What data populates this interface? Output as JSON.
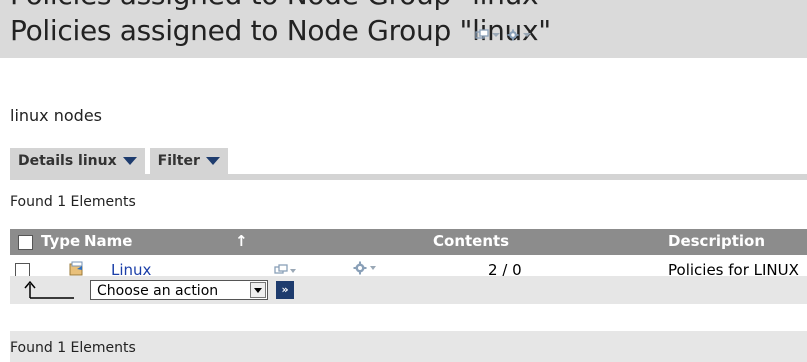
{
  "header": {
    "title_cut": "Policies assigned to Node Group \"linux\"",
    "title": "Policies assigned to Node Group \"linux\"",
    "title_tool_icons": [
      "window-icon",
      "gear-icon"
    ]
  },
  "subtitle": "linux nodes",
  "tabs": [
    {
      "label": "Details linux"
    },
    {
      "label": "Filter"
    }
  ],
  "found_top": "Found 1 Elements",
  "found_bottom": "Found 1 Elements",
  "table": {
    "headers": {
      "type": "Type",
      "name": "Name",
      "contents": "Contents",
      "description": "Description"
    },
    "rows": [
      {
        "name": "Linux",
        "contents": "2 / 0",
        "description": "Policies for LINUX"
      }
    ]
  },
  "action": {
    "select_value": "Choose an action",
    "go_label": "»"
  },
  "colors": {
    "header_bg": "#8c8c8c",
    "tab_bg": "#d4d4d4",
    "link": "#1a3ea8",
    "accent": "#1e3c6e"
  }
}
